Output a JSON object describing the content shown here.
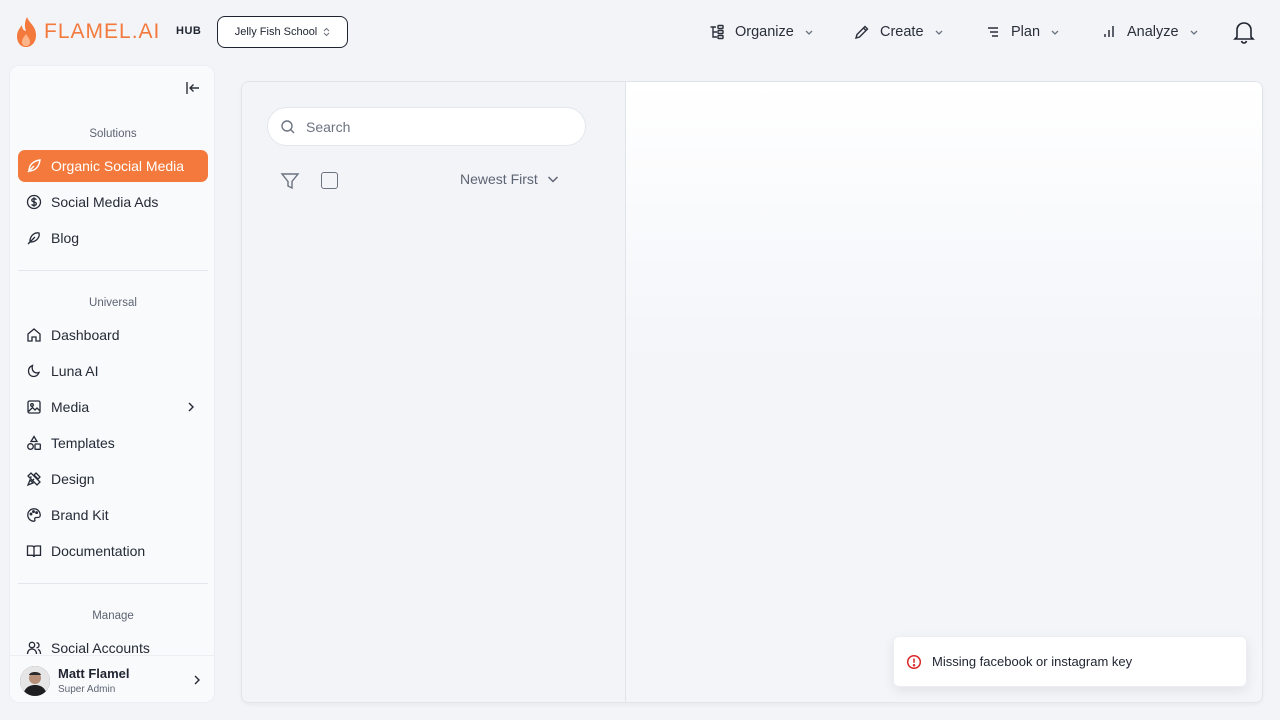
{
  "brand": {
    "name": "FLAMEL.AI",
    "hub": "HUB",
    "accent": "#f37a3c"
  },
  "org_selector": {
    "value": "Jelly Fish School"
  },
  "nav": [
    {
      "label": "Organize",
      "icon": "organize-icon"
    },
    {
      "label": "Create",
      "icon": "pencil-icon"
    },
    {
      "label": "Plan",
      "icon": "plan-icon"
    },
    {
      "label": "Analyze",
      "icon": "bar-chart-icon"
    }
  ],
  "sidebar": {
    "sections": {
      "solutions": "Solutions",
      "universal": "Universal",
      "manage": "Manage"
    },
    "items": [
      {
        "label": "Organic Social Media",
        "icon": "leaf-icon",
        "active": true
      },
      {
        "label": "Social Media Ads",
        "icon": "dollar-circle-icon"
      },
      {
        "label": "Blog",
        "icon": "feather-icon"
      },
      {
        "label": "Dashboard",
        "icon": "home-icon"
      },
      {
        "label": "Luna AI",
        "icon": "moon-icon"
      },
      {
        "label": "Media",
        "icon": "image-icon"
      },
      {
        "label": "Templates",
        "icon": "shapes-icon"
      },
      {
        "label": "Design",
        "icon": "design-tools-icon"
      },
      {
        "label": "Brand Kit",
        "icon": "palette-icon"
      },
      {
        "label": "Documentation",
        "icon": "book-icon"
      },
      {
        "label": "Social Accounts",
        "icon": "users-icon"
      }
    ],
    "user": {
      "name": "Matt Flamel",
      "role": "Super Admin"
    }
  },
  "content": {
    "search_placeholder": "Search",
    "sort_label": "Newest First"
  },
  "toast": {
    "message": "Missing facebook or instagram key",
    "color": "#dc2626"
  }
}
